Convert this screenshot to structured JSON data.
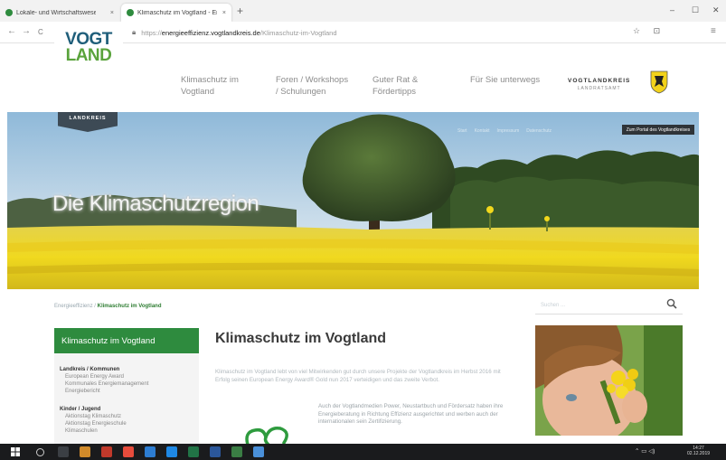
{
  "browser": {
    "tabs": [
      {
        "title": "Lokale- und Wirtschaftswesen - V..."
      },
      {
        "title": "Klimaschutz im Vogtland - Ene..."
      }
    ],
    "new_tab_symbol": "+",
    "close_symbol": "×",
    "window_controls": {
      "minimize": "–",
      "maximize": "☐",
      "close": "✕"
    },
    "nav": {
      "back": "←",
      "forward": "→",
      "reload": "C"
    },
    "url": {
      "scheme": "https://",
      "host": "energieeffizienz.vogtlandkreis.de",
      "path": "/Klimaschutz-im-Vogtland"
    },
    "url_icons": "☆ ⊡",
    "menu_icon": "≡"
  },
  "site": {
    "logo": {
      "line1": "VOGT",
      "line2": "LAND",
      "badge": "LANDKREIS"
    },
    "menu": [
      {
        "line1": "Klimaschutz im",
        "line2": "Vogtland"
      },
      {
        "line1": "Foren / Workshops",
        "line2": "/ Schulungen"
      },
      {
        "line1": "Guter Rat &",
        "line2": "Fördertipps"
      },
      {
        "line1": "Für Sie unterwegs",
        "line2": ""
      }
    ],
    "county": {
      "name": "VOGTLANDKREIS",
      "sub": "LANDRATSAMT"
    },
    "hero": {
      "title": "Die Klimaschutzregion",
      "service_links": [
        "Start",
        "Kontakt",
        "Impressum",
        "Datenschutz"
      ],
      "portal_button": "Zum Portal des Vogtlandkreises"
    },
    "breadcrumb": {
      "root": "Energieeffizienz",
      "sep": " / ",
      "current": "Klimaschutz im Vogtland"
    },
    "search": {
      "placeholder": "Suchen ...",
      "icon": "⚲"
    },
    "sidenav": {
      "heading": "Klimaschutz im Vogtland",
      "groups": [
        {
          "title": "Landkreis / Kommunen",
          "items": [
            "European Energy Award",
            "Kommunales Energiemanagement",
            "Energiebericht"
          ]
        },
        {
          "title": "Kinder / Jugend",
          "items": [
            "Aktionstag Klimaschutz",
            "Aktionstag Energieschule",
            "Klimaschulen"
          ]
        }
      ]
    },
    "content": {
      "heading": "Klimaschutz im Vogtland",
      "intro": "Klimaschutz im Vogtland lebt von viel Mitwirkenden gut durch unsere Projekte der Vogtlandkreis im Herbst 2016 mit Erfolg seinen European Energy Award® Gold nun 2017 verteidigen und das zweite Verbot.",
      "para2": "Auch der Vogtlandmedien Power, Neustartbuch und Fördersatz haben ihre Energieberatung in Richtung Effizienz ausgerichtet und werben auch der internationalen sein Zertifizierung."
    }
  },
  "taskbar": {
    "tray": "⌃ ▭ ◁) ",
    "time": "14:27",
    "date": "02.12.2019"
  },
  "colors": {
    "accent_green": "#2e8b3e",
    "logo_blue": "#1f5e7a",
    "logo_green": "#5aa33c",
    "badge_dark": "#3d4a55"
  }
}
